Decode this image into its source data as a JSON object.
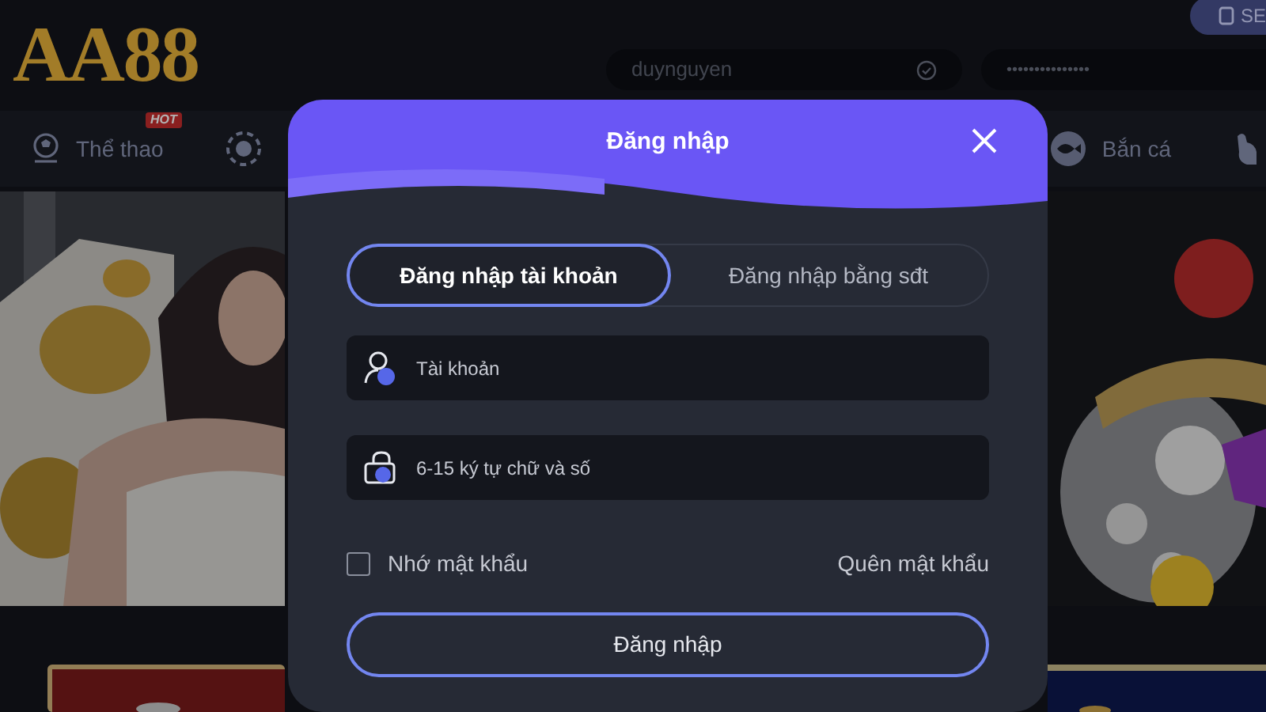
{
  "logo": "AA88",
  "header": {
    "account_button": "SE",
    "username": "duynguyen",
    "password": "•••••••••••••••"
  },
  "nav": [
    {
      "label": "Thể thao",
      "badge": "HOT"
    },
    {
      "label": "Bắn cá"
    }
  ],
  "modal": {
    "title": "Đăng nhập",
    "tabs": [
      {
        "label": "Đăng nhập tài khoản",
        "selected": true
      },
      {
        "label": "Đăng nhập bằng sđt",
        "selected": false
      }
    ],
    "fields": [
      {
        "kind": "user",
        "placeholder": "Tài khoản"
      },
      {
        "kind": "lock",
        "placeholder": "6-15 ký tự chữ và số"
      }
    ],
    "remember": {
      "label": "Nhớ mật khẩu",
      "checked": false
    },
    "forgot": "Quên mật khẩu",
    "submit": "Đăng nhập"
  }
}
